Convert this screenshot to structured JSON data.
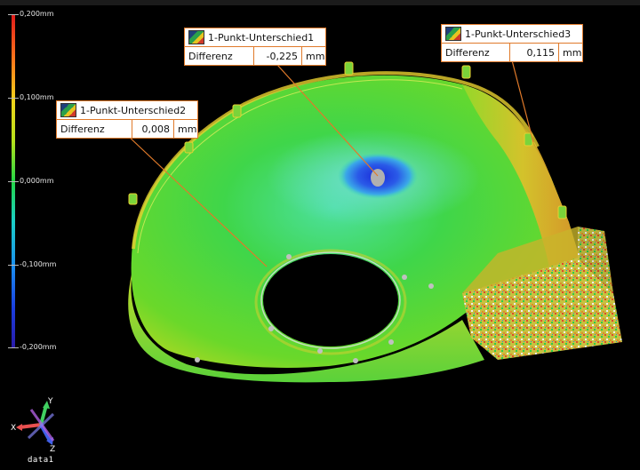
{
  "color_scale": {
    "ticks": [
      "0,200mm",
      "0,100mm",
      "0,000mm",
      "-0,100mm",
      "-0,200mm"
    ]
  },
  "callouts": [
    {
      "title": "1-Punkt-Unterschied1",
      "label": "Differenz",
      "value": "-0,225",
      "unit": "mm"
    },
    {
      "title": "1-Punkt-Unterschied2",
      "label": "Differenz",
      "value": "0,008",
      "unit": "mm"
    },
    {
      "title": "1-Punkt-Unterschied3",
      "label": "Differenz",
      "value": "0,115",
      "unit": "mm"
    }
  ],
  "axes_widget": {
    "x": "X",
    "y": "Y",
    "z": "Z",
    "label": "data1"
  },
  "colors": {
    "accent_border": "#e07a2a",
    "background": "#000000"
  }
}
